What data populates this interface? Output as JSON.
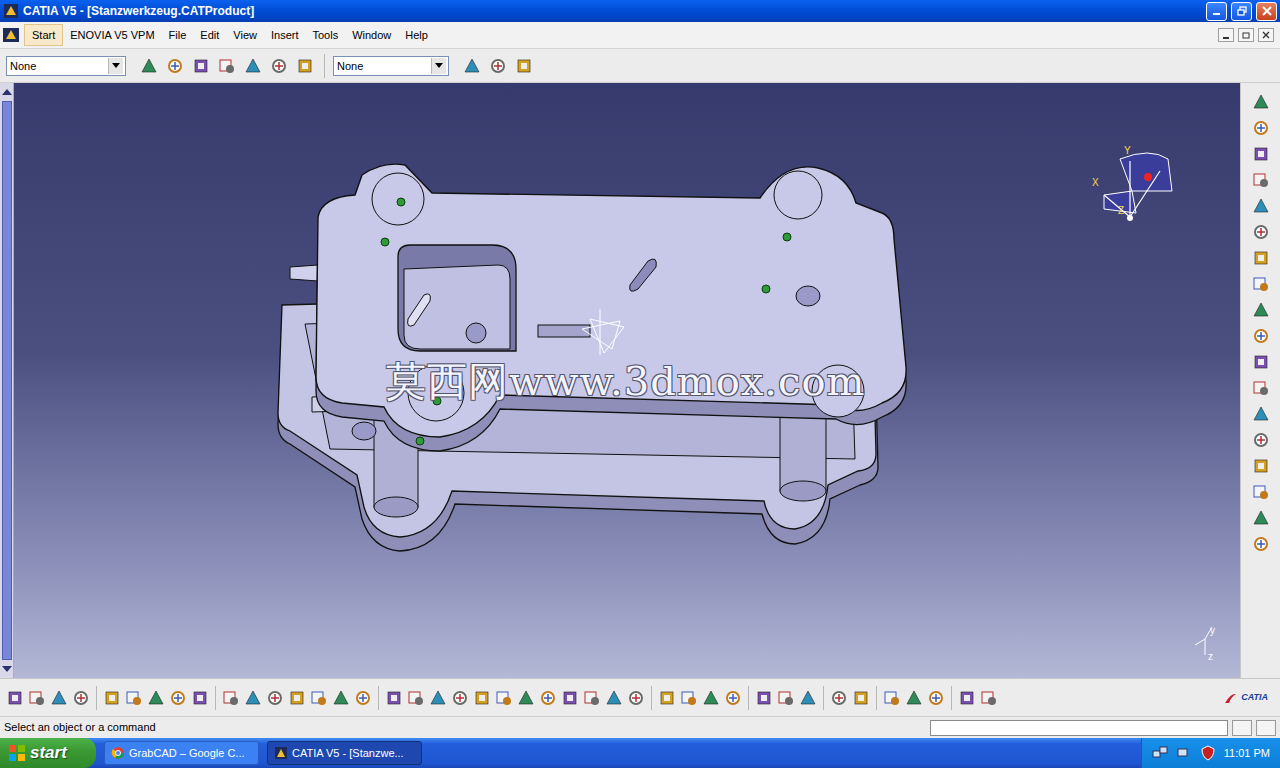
{
  "window": {
    "title": "CATIA V5 - [Stanzwerkzeug.CATProduct]"
  },
  "menu": [
    {
      "label": "Start",
      "selected": true
    },
    {
      "label": "ENOVIA V5 VPM",
      "selected": false
    },
    {
      "label": "File",
      "selected": false
    },
    {
      "label": "Edit",
      "selected": false
    },
    {
      "label": "View",
      "selected": false
    },
    {
      "label": "Insert",
      "selected": false
    },
    {
      "label": "Tools",
      "selected": false
    },
    {
      "label": "Window",
      "selected": false
    },
    {
      "label": "Help",
      "selected": false
    }
  ],
  "toolbar": {
    "selects": [
      "None",
      "None"
    ],
    "logo": "CATIA"
  },
  "viewport": {
    "watermark": "莫西网www.3dmox.com",
    "compass": {
      "x": "X",
      "y": "Y",
      "z": "Z"
    },
    "axis": {
      "y": "y",
      "z": "z"
    }
  },
  "status_bar": {
    "text": "Select an object or a command"
  },
  "taskbar": {
    "start": "start",
    "tasks": [
      {
        "label": "GrabCAD – Google C...",
        "selected": false
      },
      {
        "label": "CATIA V5 - [Stanzwe...",
        "selected": true
      }
    ],
    "time": "11:01 PM"
  }
}
